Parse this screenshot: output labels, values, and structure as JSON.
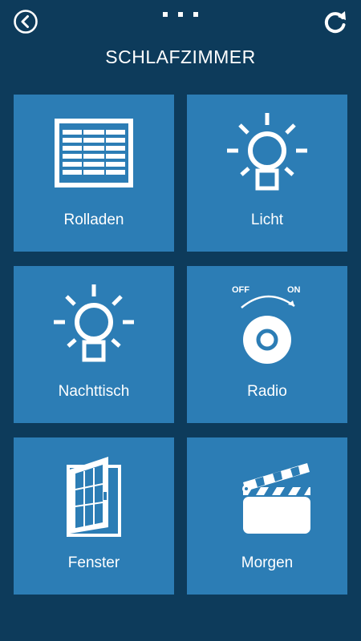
{
  "header": {
    "title": "SCHLAFZIMMER",
    "back_icon": "back-icon",
    "menu_icon": "more-dots-icon",
    "refresh_icon": "refresh-icon"
  },
  "tiles": [
    {
      "label": "Rolladen",
      "icon": "roller-shutter-icon"
    },
    {
      "label": "Licht",
      "icon": "light-bulb-icon"
    },
    {
      "label": "Nachttisch",
      "icon": "light-bulb-icon"
    },
    {
      "label": "Radio",
      "icon": "radio-dial-icon",
      "dial_off": "OFF",
      "dial_on": "ON"
    },
    {
      "label": "Fenster",
      "icon": "window-icon"
    },
    {
      "label": "Morgen",
      "icon": "clapperboard-icon"
    }
  ],
  "colors": {
    "background": "#0d3b5b",
    "tile": "#2c7db5",
    "foreground": "#ffffff"
  }
}
